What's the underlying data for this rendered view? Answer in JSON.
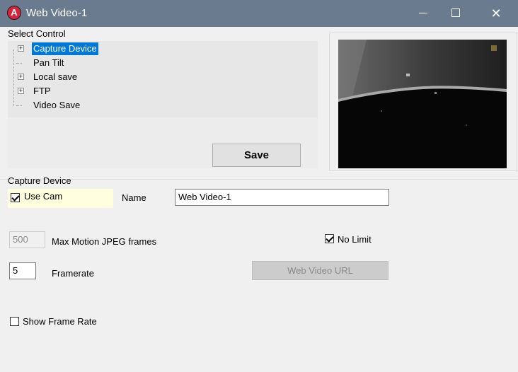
{
  "window": {
    "title": "Web Video-1",
    "icon_letter": "A",
    "minimize_icon": "minimize-icon",
    "maximize_icon": "maximize-icon",
    "close_glyph": "✕"
  },
  "select_control": {
    "label": "Select Control",
    "tree": [
      {
        "label": "Capture Device",
        "expandable": true,
        "selected": true
      },
      {
        "label": "Pan Tilt",
        "expandable": false,
        "selected": false
      },
      {
        "label": "Local save",
        "expandable": true,
        "selected": false
      },
      {
        "label": "FTP",
        "expandable": true,
        "selected": false
      },
      {
        "label": "Video Save",
        "expandable": false,
        "selected": false
      }
    ],
    "expander_glyph": "+",
    "save_label": "Save"
  },
  "capture_device": {
    "section_label": "Capture Device",
    "use_cam_label": "Use Cam",
    "use_cam_checked": true,
    "name_label": "Name",
    "name_value": "Web Video-1",
    "max_frames_value": "500",
    "max_frames_label": "Max Motion JPEG frames",
    "no_limit_label": "No Limit",
    "no_limit_checked": true,
    "framerate_value": "5",
    "framerate_label": "Framerate",
    "web_video_url_label": "Web Video URL",
    "show_frame_rate_label": "Show Frame Rate",
    "show_frame_rate_checked": false
  },
  "colors": {
    "titlebar": "#6b7b8f",
    "selection": "#0078d7",
    "highlight_bg": "#ffffe0"
  }
}
